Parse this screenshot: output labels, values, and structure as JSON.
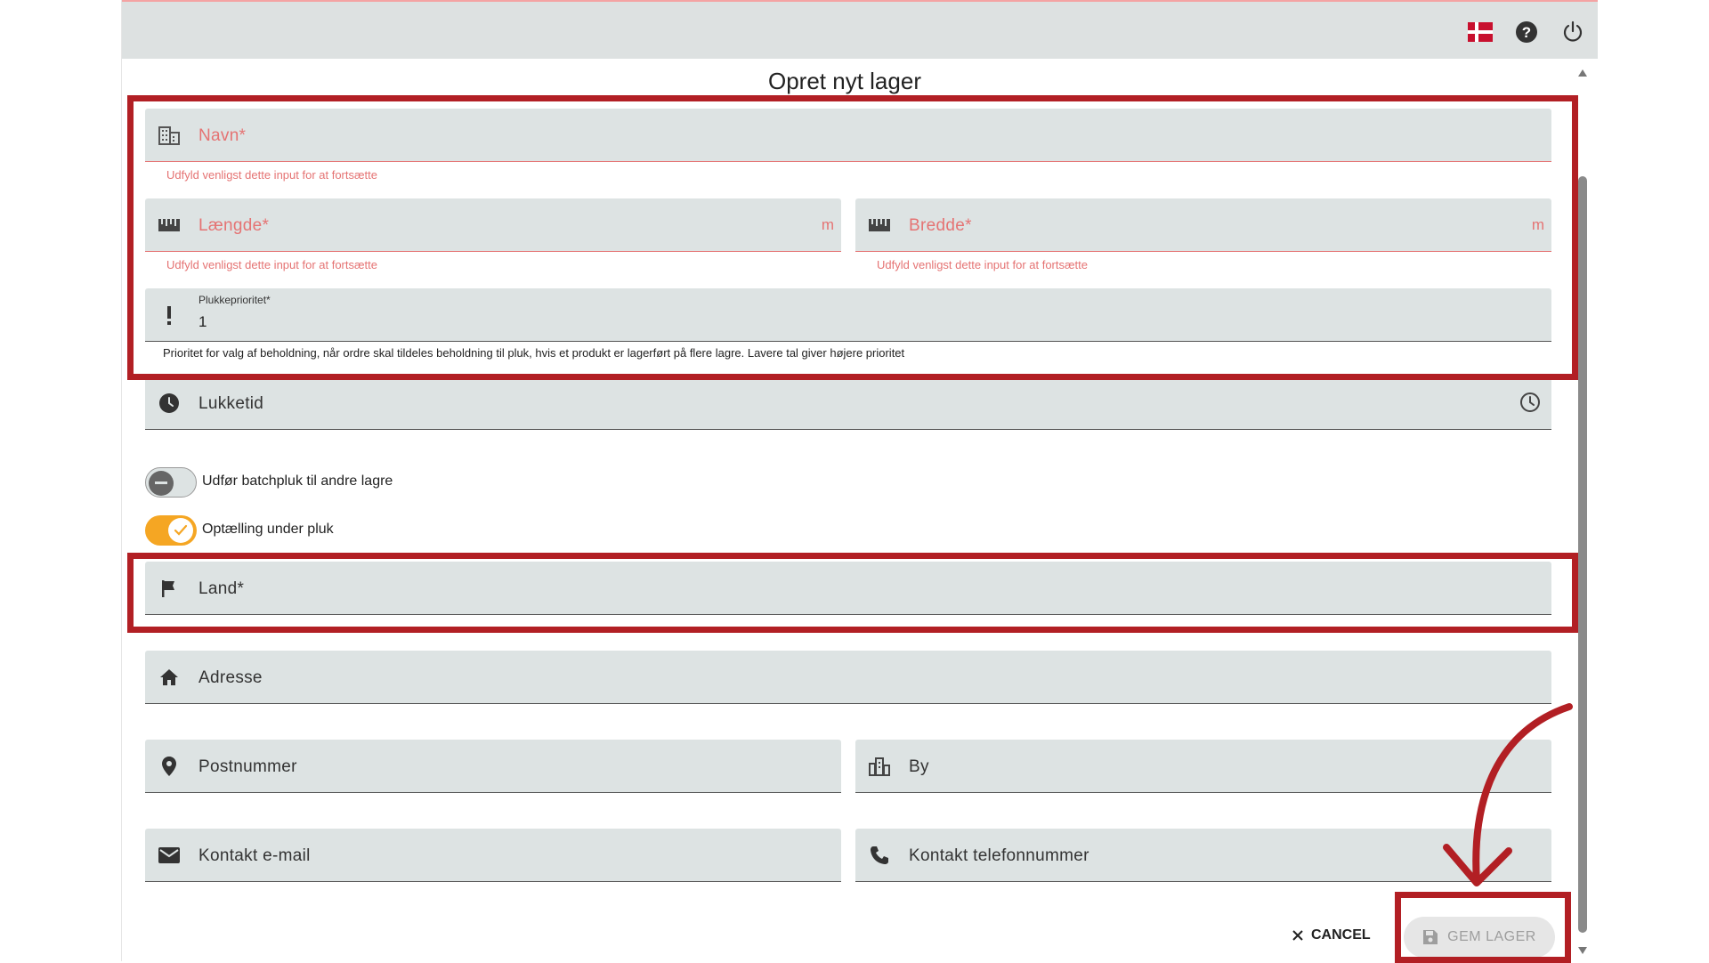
{
  "topbar": {
    "flag_icon": "danish-flag-icon",
    "help_icon": "question-circle-icon",
    "power_icon": "power-icon"
  },
  "dialog": {
    "title": "Opret nyt lager",
    "fields": {
      "name": {
        "label": "Navn*",
        "error": "Udfyld venligst dette input for at fortsætte",
        "icon": "building-icon"
      },
      "length": {
        "label": "Længde*",
        "suffix": "m",
        "error": "Udfyld venligst dette input for at fortsætte",
        "icon": "ruler-icon"
      },
      "width": {
        "label": "Bredde*",
        "suffix": "m",
        "error": "Udfyld venligst dette input for at fortsætte",
        "icon": "ruler-icon"
      },
      "pick_priority": {
        "label": "Plukkeprioritet*",
        "value": "1",
        "hint": "Prioritet for valg af beholdning, når ordre skal tildeles beholdning til pluk, hvis et produkt er lagerført på flere lagre. Lavere tal giver højere prioritet",
        "icon": "exclamation-icon"
      },
      "closing_time": {
        "label": "Lukketid",
        "icon": "clock-icon"
      },
      "country": {
        "label": "Land*",
        "icon": "flag-icon"
      },
      "address": {
        "label": "Adresse",
        "icon": "home-icon"
      },
      "postal_code": {
        "label": "Postnummer",
        "icon": "location-pin-icon"
      },
      "city": {
        "label": "By",
        "icon": "city-icon"
      },
      "contact_email": {
        "label": "Kontakt e-mail",
        "icon": "mail-icon"
      },
      "contact_phone": {
        "label": "Kontakt telefonnummer",
        "icon": "phone-icon"
      }
    },
    "toggles": {
      "batch_pick": {
        "label": "Udfør batchpluk til andre lagre",
        "on": false
      },
      "count_during_pick": {
        "label": "Optælling under pluk",
        "on": true
      }
    },
    "actions": {
      "cancel_label": "CANCEL",
      "save_label": "GEM LAGER"
    }
  },
  "colors": {
    "accent_red": "#b21f24",
    "error": "#e57373",
    "toggle_on": "#f5a623",
    "field_bg": "#dde3e3"
  }
}
